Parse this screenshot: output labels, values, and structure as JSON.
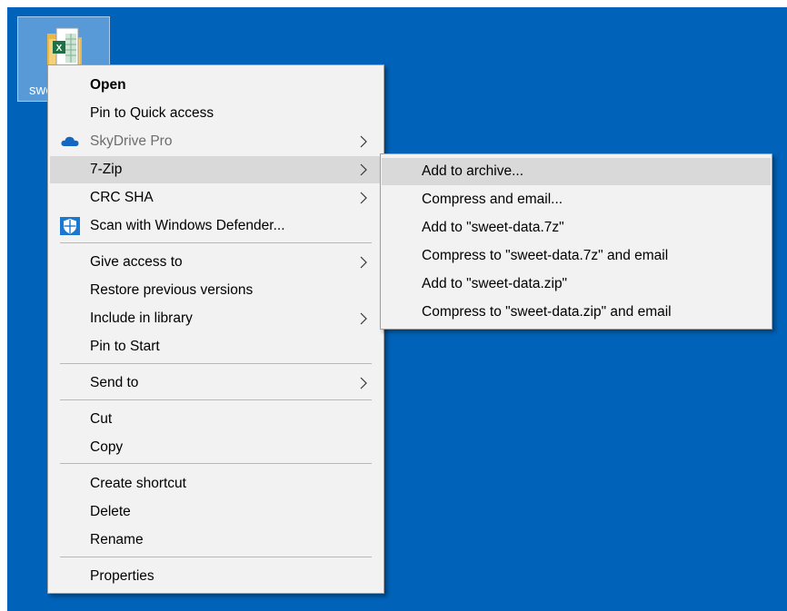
{
  "desktop": {
    "background_color": "#0062b8",
    "file": {
      "label": "sweet-data.xlsx",
      "icon": "excel-file-icon"
    }
  },
  "context_menu": {
    "items": [
      {
        "label": "Open",
        "bold": true
      },
      {
        "label": "Pin to Quick access"
      },
      {
        "label": "SkyDrive Pro",
        "icon": "skydrive-cloud-icon",
        "submenu": true,
        "disabled": true
      },
      {
        "label": "7-Zip",
        "submenu": true,
        "highlighted": true
      },
      {
        "label": "CRC SHA",
        "submenu": true
      },
      {
        "label": "Scan with Windows Defender...",
        "icon": "windows-defender-icon"
      },
      {
        "label": "Give access to",
        "submenu": true
      },
      {
        "label": "Restore previous versions"
      },
      {
        "label": "Include in library",
        "submenu": true
      },
      {
        "label": "Pin to Start"
      },
      {
        "label": "Send to",
        "submenu": true
      },
      {
        "label": "Cut"
      },
      {
        "label": "Copy"
      },
      {
        "label": "Create shortcut"
      },
      {
        "label": "Delete"
      },
      {
        "label": "Rename"
      },
      {
        "label": "Properties"
      }
    ]
  },
  "submenu_7zip": {
    "items": [
      {
        "label": "Add to archive...",
        "highlighted": true
      },
      {
        "label": "Compress and email..."
      },
      {
        "label": "Add to \"sweet-data.7z\""
      },
      {
        "label": "Compress to \"sweet-data.7z\" and email"
      },
      {
        "label": "Add to \"sweet-data.zip\""
      },
      {
        "label": "Compress to \"sweet-data.zip\" and email"
      }
    ]
  }
}
